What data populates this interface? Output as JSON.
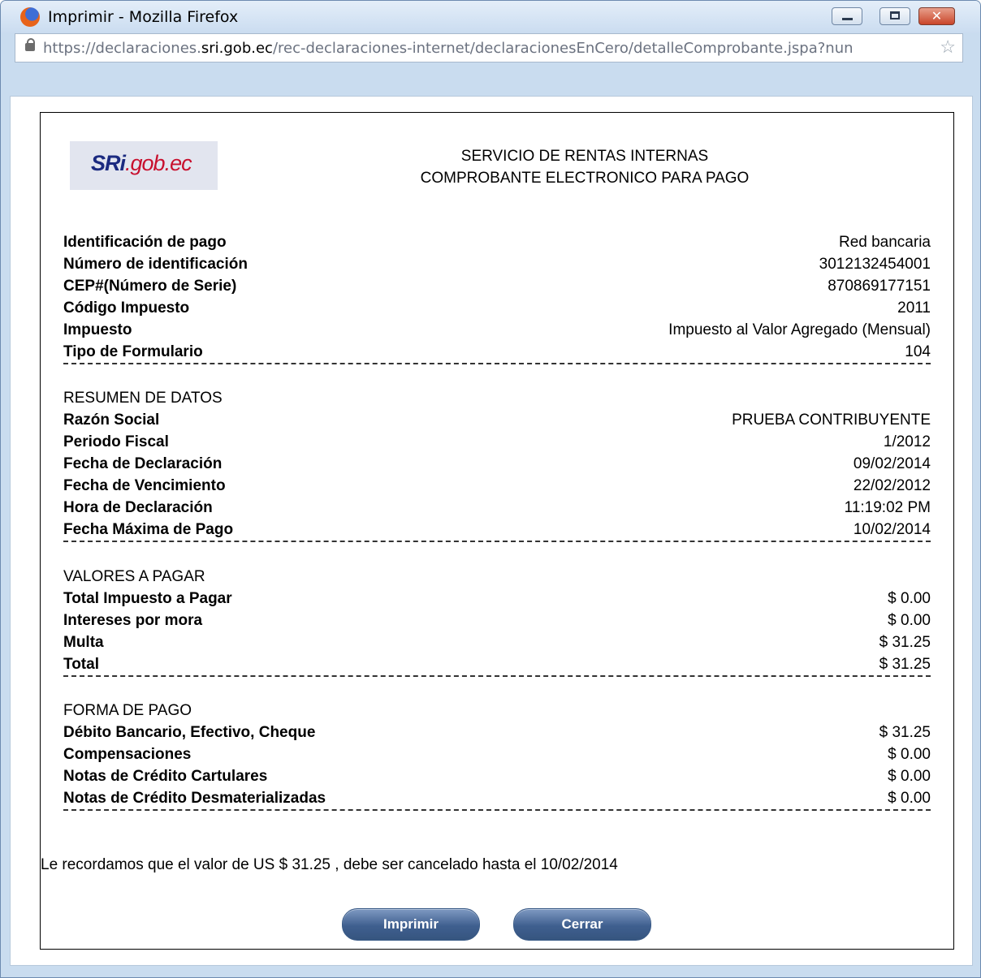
{
  "window": {
    "title": "Imprimir - Mozilla Firefox",
    "url_prefix": "https://declaraciones.",
    "url_host": "sri.gob.ec",
    "url_path": "/rec-declaraciones-internet/declaracionesEnCero/detalleComprobante.jspa?nun",
    "close_glyph": "✕"
  },
  "logo": {
    "part1": "SRi",
    "part2": ".gob.ec"
  },
  "header": {
    "line1": "SERVICIO DE RENTAS INTERNAS",
    "line2": "COMPROBANTE ELECTRONICO PARA PAGO"
  },
  "identificacion": [
    {
      "label": "Identificación de pago",
      "value": "Red bancaria"
    },
    {
      "label": "Número de identificación",
      "value": "3012132454001"
    },
    {
      "label": "CEP#(Número de Serie)",
      "value": "870869177151"
    },
    {
      "label": "Código Impuesto",
      "value": "2011"
    },
    {
      "label": "Impuesto",
      "value": "Impuesto al Valor Agregado (Mensual)"
    },
    {
      "label": "Tipo de Formulario",
      "value": "104"
    }
  ],
  "resumen": {
    "title": "RESUMEN DE DATOS",
    "rows": [
      {
        "label": "Razón Social",
        "value": "PRUEBA CONTRIBUYENTE"
      },
      {
        "label": "Periodo Fiscal",
        "value": "1/2012"
      },
      {
        "label": "Fecha de Declaración",
        "value": "09/02/2014"
      },
      {
        "label": "Fecha de Vencimiento",
        "value": "22/02/2012"
      },
      {
        "label": "Hora de Declaración",
        "value": "11:19:02 PM"
      },
      {
        "label": "Fecha Máxima de Pago",
        "value": "10/02/2014"
      }
    ]
  },
  "valores": {
    "title": "VALORES A PAGAR",
    "rows": [
      {
        "label": "Total Impuesto a Pagar",
        "value": "$ 0.00"
      },
      {
        "label": "Intereses por mora",
        "value": "$ 0.00"
      },
      {
        "label": "Multa",
        "value": "$ 31.25"
      },
      {
        "label": "Total",
        "value": "$ 31.25"
      }
    ]
  },
  "forma": {
    "title": "FORMA DE PAGO",
    "rows": [
      {
        "label": "Débito Bancario, Efectivo, Cheque",
        "value": "$ 31.25"
      },
      {
        "label": "Compensaciones",
        "value": "$ 0.00"
      },
      {
        "label": "Notas de Crédito Cartulares",
        "value": "$ 0.00"
      },
      {
        "label": "Notas de Crédito Desmaterializadas",
        "value": "$ 0.00"
      }
    ]
  },
  "reminder": "Le recordamos que el valor de US  $ 31.25  , debe ser cancelado hasta el  10/02/2014",
  "buttons": {
    "print": "Imprimir",
    "close": "Cerrar"
  }
}
